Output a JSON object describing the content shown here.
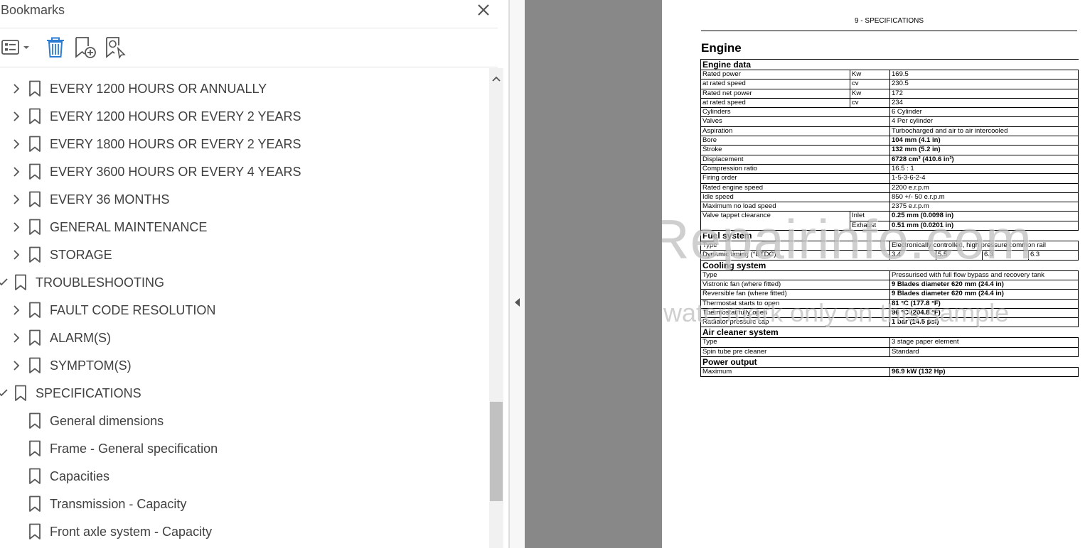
{
  "bookmarks_panel": {
    "title": "Bookmarks",
    "toolbar": {
      "options_icon": "list-options-icon",
      "delete_icon": "trash-icon",
      "new_bookmark_icon": "add-bookmark-icon",
      "find_bookmark_icon": "find-bookmark-icon"
    },
    "items": [
      {
        "label": "EVERY 1200 HOURS OR ANNUALLY",
        "state": "collapsed",
        "level": 1
      },
      {
        "label": "EVERY 1200 HOURS OR EVERY 2 YEARS",
        "state": "collapsed",
        "level": 1
      },
      {
        "label": "EVERY 1800 HOURS OR EVERY 2 YEARS",
        "state": "collapsed",
        "level": 1
      },
      {
        "label": "EVERY 3600 HOURS OR EVERY 4 YEARS",
        "state": "collapsed",
        "level": 1
      },
      {
        "label": "EVERY 36 MONTHS",
        "state": "collapsed",
        "level": 1
      },
      {
        "label": "GENERAL MAINTENANCE",
        "state": "collapsed",
        "level": 1
      },
      {
        "label": "STORAGE",
        "state": "collapsed",
        "level": 1
      },
      {
        "label": "TROUBLESHOOTING",
        "state": "expanded",
        "level": 0
      },
      {
        "label": "FAULT CODE RESOLUTION",
        "state": "collapsed",
        "level": 1
      },
      {
        "label": "ALARM(S)",
        "state": "collapsed",
        "level": 1
      },
      {
        "label": "SYMPTOM(S)",
        "state": "collapsed",
        "level": 1
      },
      {
        "label": "SPECIFICATIONS",
        "state": "expanded",
        "level": 0
      },
      {
        "label": "General dimensions",
        "state": "leaf",
        "level": 1
      },
      {
        "label": "Frame - General specification",
        "state": "leaf",
        "level": 1
      },
      {
        "label": "Capacities",
        "state": "leaf",
        "level": 1
      },
      {
        "label": "Transmission - Capacity",
        "state": "leaf",
        "level": 1
      },
      {
        "label": "Front axle system - Capacity",
        "state": "leaf",
        "level": 1
      }
    ]
  },
  "document": {
    "running_head": "9 - SPECIFICATIONS",
    "title": "Engine",
    "watermark_line1": "eRepairinfo.com",
    "watermark_line2": "watermark only on this sample",
    "engine_data": {
      "heading": "Engine data",
      "rated_power": {
        "label": "Rated power",
        "unit": "Kw",
        "value": "169.5"
      },
      "rated_speed_1": {
        "label": "at rated speed",
        "unit": "cv",
        "value": "230.5"
      },
      "rated_net_power": {
        "label": "Rated net power",
        "unit": "Kw",
        "value": "172"
      },
      "rated_speed_2": {
        "label": "at rated speed",
        "unit": "cv",
        "value": "234"
      },
      "cylinders": {
        "label": "Cylinders",
        "value": "6 Cylinder"
      },
      "valves": {
        "label": "Valves",
        "value": "4 Per cylinder"
      },
      "aspiration": {
        "label": "Aspiration",
        "value": "Turbocharged and air to air intercooled"
      },
      "bore": {
        "label": "Bore",
        "value": "104 mm (4.1 in)"
      },
      "stroke": {
        "label": "Stroke",
        "value": "132 mm (5.2 in)"
      },
      "displacement": {
        "label": "Displacement",
        "value": "6728 cm³ (410.6 in³)"
      },
      "compression": {
        "label": "Compression ratio",
        "value": "16.5 :  1"
      },
      "firing_order": {
        "label": "Firing order",
        "value": "1-5-3-6-2-4"
      },
      "rated_engine_speed": {
        "label": "Rated engine speed",
        "value": "2200 e.r.p.m"
      },
      "idle_speed": {
        "label": "Idle speed",
        "value": "850 +/- 50 e.r.p.m"
      },
      "max_no_load": {
        "label": "Maximum no load speed",
        "value": "2375 e.r.p.m"
      },
      "valve_tappet": {
        "label": "Valve tappet clearance",
        "inlet_label": "Inlet",
        "inlet_value": "0.25 mm (0.0098 in)",
        "exhaust_label": "Exhaust",
        "exhaust_value": "0.51 mm (0.0201 in)"
      }
    },
    "fuel_system": {
      "heading": "Fuel system",
      "type": {
        "label": "Type",
        "value": "Electronically controlled, high pressure common rail"
      },
      "timing": {
        "label": "Dynamic timing (°BTDC)",
        "values": [
          "3.4",
          "5.5",
          "6.3",
          "6.3"
        ]
      }
    },
    "cooling_system": {
      "heading": "Cooling system",
      "type": {
        "label": "Type",
        "value": "Pressurised with full flow bypass and recovery tank"
      },
      "vistronic": {
        "label": "Vistronic fan (where fitted)",
        "value": "9 Blades diameter 620 mm (24.4 in)"
      },
      "reversible": {
        "label": "Reversible fan (where fitted)",
        "value": "9 Blades diameter 620 mm (24.4 in)"
      },
      "thermo_start": {
        "label": "Thermostat starts to open",
        "value": "81 °C (177.8 °F)"
      },
      "thermo_full": {
        "label": "Thermostat fully open",
        "value": "96 °C (204.8 °F)"
      },
      "rad_cap": {
        "label": "Radiator pressure cap",
        "value": "1 bar (14.5 psi)"
      }
    },
    "air_cleaner": {
      "heading": "Air cleaner system",
      "type": {
        "label": "Type",
        "value": "3 stage paper element"
      },
      "spin_tube": {
        "label": "Spin tube pre cleaner",
        "value": "Standard"
      }
    },
    "power_output": {
      "heading": "Power output",
      "maximum": {
        "label": "Maximum",
        "value": "96.9 kW (132 Hp)"
      }
    }
  },
  "colors": {
    "gutter": "#888888",
    "scroll_thumb": "#c1c1c1",
    "delete_icon": "#2a7dd3"
  }
}
